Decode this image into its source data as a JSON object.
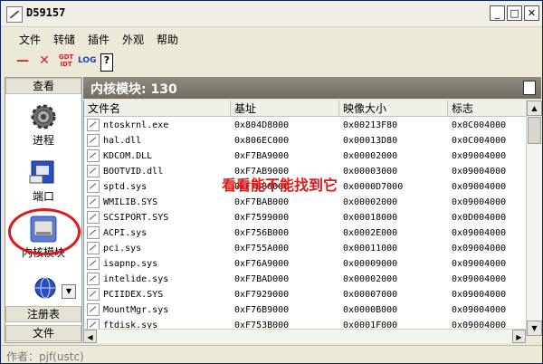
{
  "window": {
    "title": "D59157"
  },
  "menu": [
    "文件",
    "转储",
    "插件",
    "外观",
    "帮助"
  ],
  "toolbar": {
    "minus": "—",
    "close": "✕",
    "gdt_idt": "GDT IDT",
    "log": "LOG",
    "help": "?"
  },
  "sidebar": {
    "top_label": "查看",
    "items": [
      {
        "label": "进程",
        "icon": "gear-icon"
      },
      {
        "label": "端口",
        "icon": "network-port-icon"
      },
      {
        "label": "内核模块",
        "icon": "disk-drive-icon"
      }
    ],
    "bottom": [
      "注册表",
      "文件"
    ]
  },
  "panel": {
    "title": "内核模块: 130"
  },
  "table": {
    "columns": [
      "文件名",
      "基址",
      "映像大小",
      "标志"
    ],
    "rows": [
      [
        "ntoskrnl.exe",
        "0x804D8000",
        "0x00213F80",
        "0x0C004000"
      ],
      [
        "hal.dll",
        "0x806EC000",
        "0x00013D80",
        "0x0C004000"
      ],
      [
        "KDCOM.DLL",
        "0xF7BA9000",
        "0x00002000",
        "0x09004000"
      ],
      [
        "BOOTVID.dll",
        "0xF7AB9000",
        "0x00003000",
        "0x09004000"
      ],
      [
        "sptd.sys",
        "0xF7680000",
        "0x0000D7000",
        "0x09004000"
      ],
      [
        "WMILIB.SYS",
        "0xF7BAB000",
        "0x00002000",
        "0x09004000"
      ],
      [
        "SCSIPORT.SYS",
        "0xF7599000",
        "0x00018000",
        "0x0D004000"
      ],
      [
        "ACPI.sys",
        "0xF756B000",
        "0x0002E000",
        "0x09004000"
      ],
      [
        "pci.sys",
        "0xF755A000",
        "0x00011000",
        "0x09004000"
      ],
      [
        "isapnp.sys",
        "0xF76A9000",
        "0x00009000",
        "0x09004000"
      ],
      [
        "intelide.sys",
        "0xF7BAD000",
        "0x00002000",
        "0x09004000"
      ],
      [
        "PCIIDEX.SYS",
        "0xF7929000",
        "0x00007000",
        "0x09004000"
      ],
      [
        "MountMgr.sys",
        "0xF76B9000",
        "0x0000B000",
        "0x09004000"
      ],
      [
        "ftdisk.sys",
        "0xF753B000",
        "0x0001F000",
        "0x09004000"
      ]
    ]
  },
  "annotation": "看看能不能找到它",
  "status": "作者：pjf(ustc)"
}
